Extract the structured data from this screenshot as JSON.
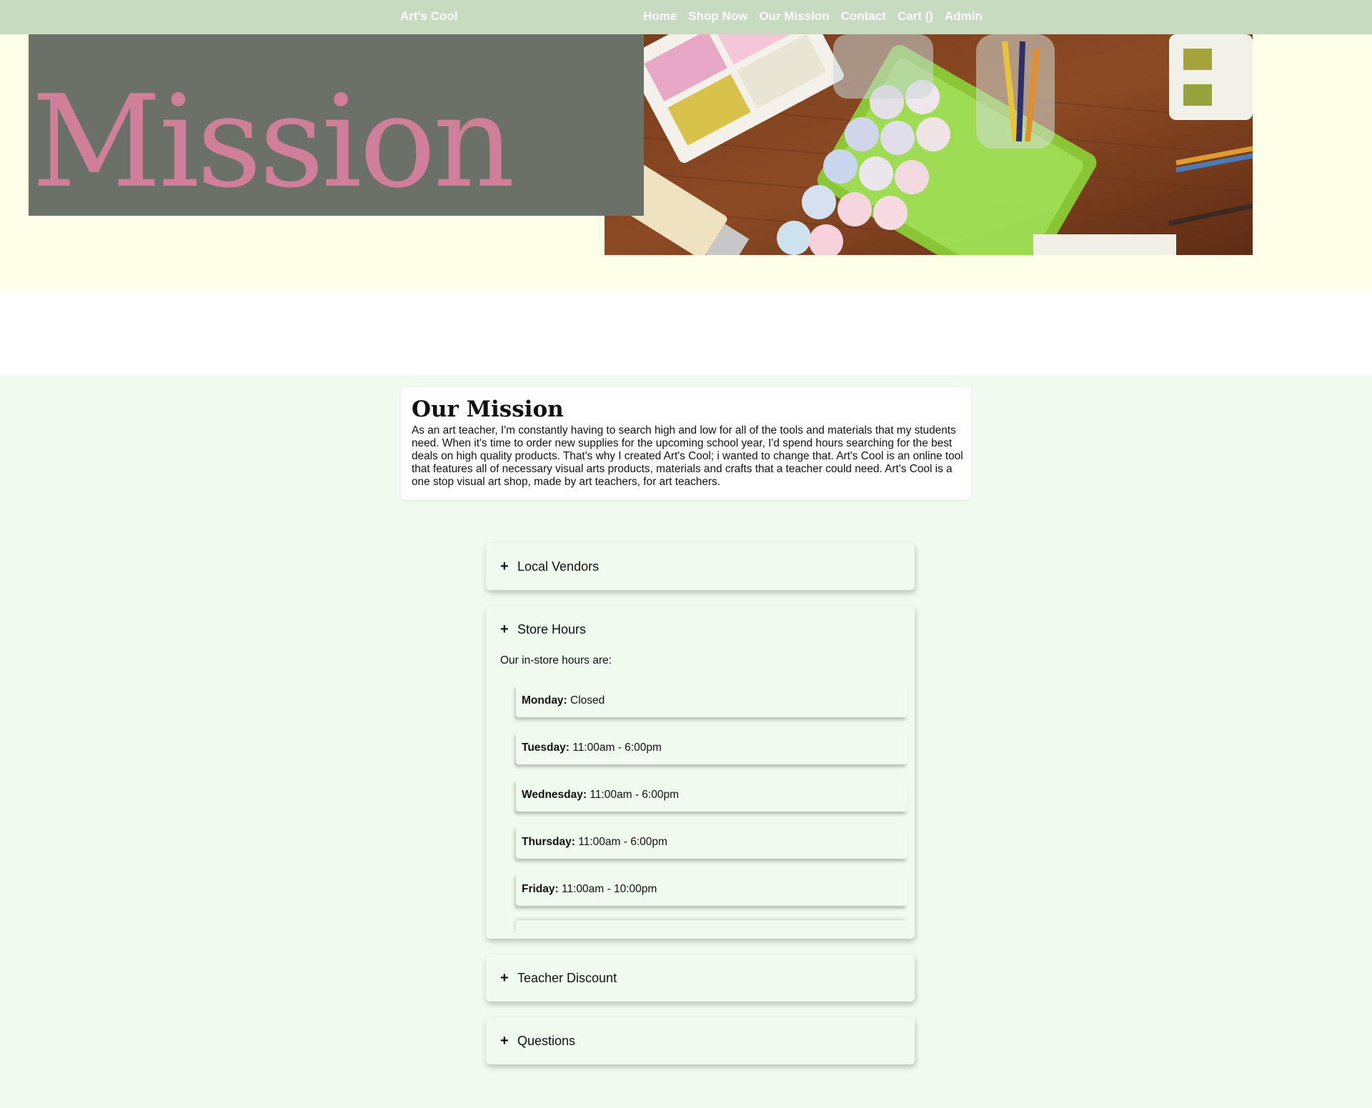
{
  "nav": {
    "brand": "Art's Cool",
    "links": [
      "Home",
      "Shop Now",
      "Our Mission",
      "Contact",
      "Cart ()",
      "Admin"
    ]
  },
  "hero": {
    "title": "Mission"
  },
  "mission": {
    "heading": "Our Mission",
    "body": "As an art teacher, I'm constantly having to search high and low for all of the tools and materials that my students need. When it's time to order new supplies for the upcoming school year, I'd spend hours searching for the best deals on high quality products. That's why I created Art's Cool; i wanted to change that. Art's Cool is an online tool that features all of necessary visual arts products, materials and crafts that a teacher could need. Art's Cool is a one stop visual art shop, made by art teachers, for art teachers."
  },
  "accordion": {
    "toggle_symbol": "+",
    "sections": [
      {
        "label": "Local Vendors"
      },
      {
        "label": "Store Hours",
        "intro": "Our in-store hours are:"
      },
      {
        "label": "Teacher Discount"
      },
      {
        "label": "Questions"
      }
    ],
    "hours": [
      {
        "day": "Monday:",
        "time": "Closed"
      },
      {
        "day": "Tuesday:",
        "time": "11:00am - 6:00pm"
      },
      {
        "day": "Wednesday:",
        "time": "11:00am - 6:00pm"
      },
      {
        "day": "Thursday:",
        "time": "11:00am - 6:00pm"
      },
      {
        "day": "Friday:",
        "time": "11:00am - 10:00pm"
      }
    ]
  },
  "colors": {
    "nav_bg": "#c6dbbf",
    "hero_bg": "#feffe8",
    "title_box": "#6b7169",
    "title_text": "#cf7f97",
    "page_bg": "#eefbee"
  }
}
